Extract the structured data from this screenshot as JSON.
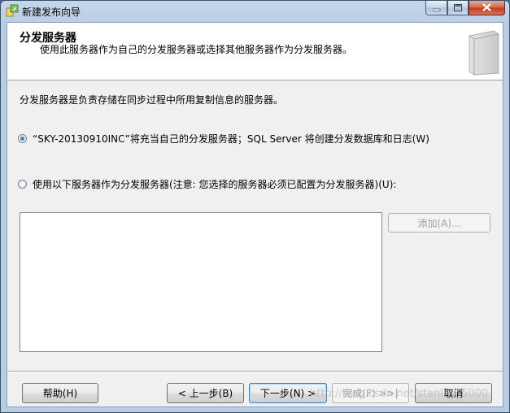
{
  "window": {
    "title": "新建发布向导",
    "minimize_icon": "minimize-icon",
    "maximize_icon": "maximize-icon",
    "close_icon": "close-icon"
  },
  "header": {
    "title": "分发服务器",
    "subtitle": "使用此服务器作为自己的分发服务器或选择其他服务器作为分发服务器。"
  },
  "body": {
    "intro": "分发服务器是负责存储在同步过程中所用复制信息的服务器。",
    "option_self_label": "“SKY-20130910INC”将充当自己的分发服务器；SQL Server 将创建分发数据库和日志(W)",
    "option_self_checked": true,
    "option_other_label": "使用以下服务器作为分发服务器(注意: 您选择的服务器必须已配置为分发服务器)(U):",
    "option_other_checked": false,
    "add_button": "添加(A)..."
  },
  "footer": {
    "help": "帮助(H)",
    "back": "< 上一步(B)",
    "next": "下一步(N) >",
    "finish": "完成(F) >>|",
    "cancel": "取消"
  },
  "watermark": "http://blog.csdn.net/stanley_5000"
}
